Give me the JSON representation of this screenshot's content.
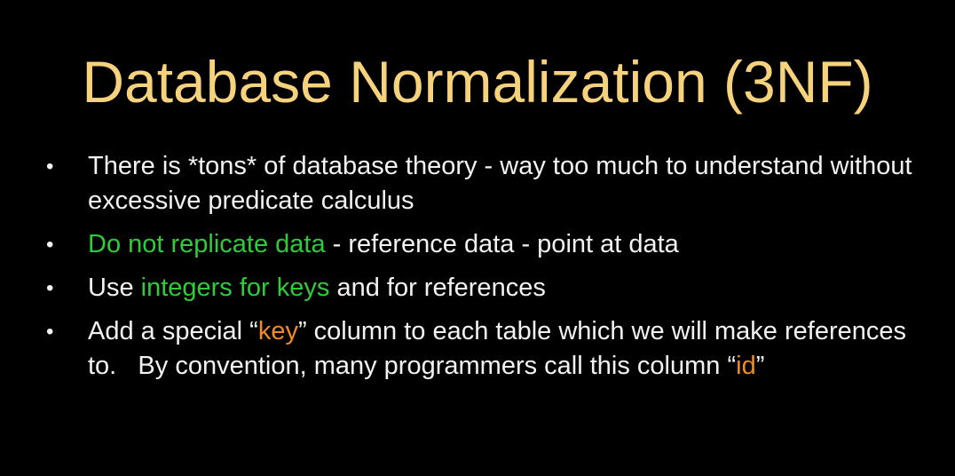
{
  "colors": {
    "background": "#000000",
    "title": "#F6D27D",
    "body": "#F2F2F2",
    "green": "#2FCB3A",
    "orange": "#F08A24"
  },
  "title": "Database Normalization (3NF)",
  "bullet_glyph": "•",
  "bullets": [
    {
      "segments": [
        {
          "text": "There is *tons* of database theory - way too much to understand without excessive predicate calculus",
          "color": "body"
        }
      ]
    },
    {
      "segments": [
        {
          "text": "Do not replicate data",
          "color": "green"
        },
        {
          "text": " - reference data - point at data",
          "color": "body"
        }
      ]
    },
    {
      "segments": [
        {
          "text": "Use ",
          "color": "body"
        },
        {
          "text": "integers for keys",
          "color": "green"
        },
        {
          "text": " and for references",
          "color": "body"
        }
      ]
    },
    {
      "segments": [
        {
          "text": "Add a special “",
          "color": "body"
        },
        {
          "text": "key",
          "color": "orange"
        },
        {
          "text": "” column to each table which we will make references to.   By convention, many programmers call this column “",
          "color": "body"
        },
        {
          "text": "id",
          "color": "orange"
        },
        {
          "text": "”",
          "color": "body"
        }
      ]
    }
  ]
}
